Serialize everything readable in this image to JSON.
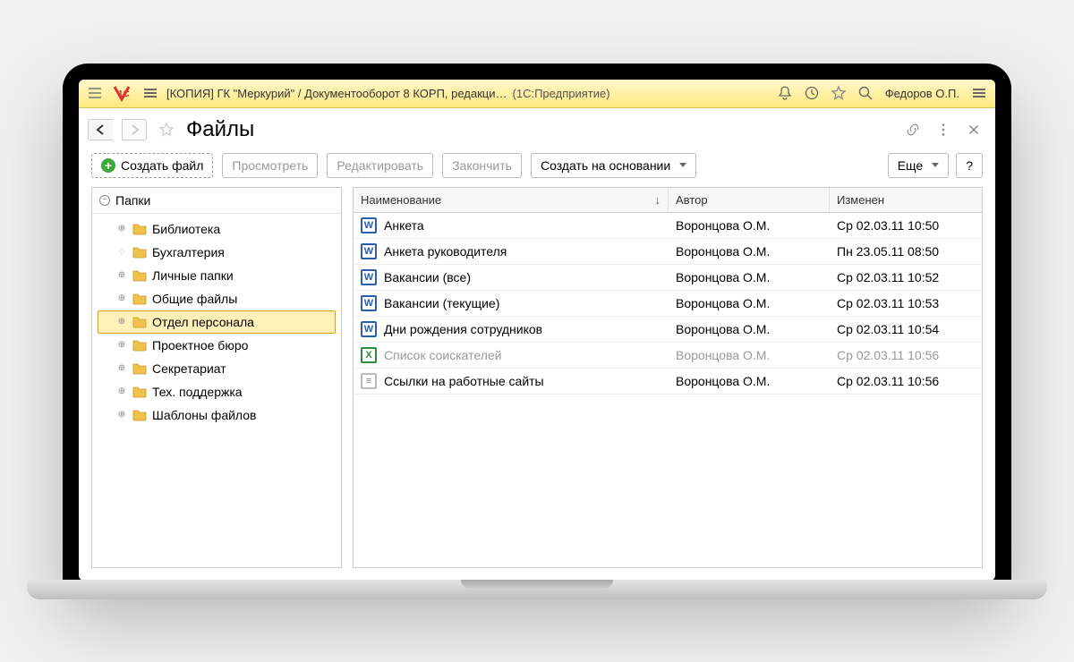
{
  "title_bar": {
    "app_title": "[КОПИЯ] ГК \"Меркурий\" / Документооборот 8 КОРП, редакци…",
    "subsystem": "(1С:Предприятие)",
    "user_name": "Федоров О.П."
  },
  "page": {
    "title": "Файлы"
  },
  "toolbar": {
    "create_file": "Создать файл",
    "view": "Просмотреть",
    "edit": "Редактировать",
    "finish": "Закончить",
    "create_from": "Создать на основании",
    "more": "Еще",
    "help": "?"
  },
  "tree": {
    "root": "Папки",
    "items": [
      {
        "label": "Библиотека",
        "expandable": true
      },
      {
        "label": "Бухгалтерия",
        "expandable": false,
        "loading": true
      },
      {
        "label": "Личные папки",
        "expandable": true
      },
      {
        "label": "Общие файлы",
        "expandable": true
      },
      {
        "label": "Отдел персонала",
        "expandable": true,
        "selected": true
      },
      {
        "label": "Проектное бюро",
        "expandable": true
      },
      {
        "label": "Секретариат",
        "expandable": true
      },
      {
        "label": "Тех. поддержка",
        "expandable": true
      },
      {
        "label": "Шаблоны файлов",
        "expandable": true
      }
    ]
  },
  "grid": {
    "columns": {
      "name": "Наименование",
      "author": "Автор",
      "modified": "Изменен"
    },
    "rows": [
      {
        "type": "word",
        "name": "Анкета",
        "author": "Воронцова О.М.",
        "modified": "Ср 02.03.11 10:50"
      },
      {
        "type": "word",
        "name": "Анкета руководителя",
        "author": "Воронцова О.М.",
        "modified": "Пн 23.05.11 08:50"
      },
      {
        "type": "word",
        "name": "Вакансии (все)",
        "author": "Воронцова О.М.",
        "modified": "Ср 02.03.11 10:52"
      },
      {
        "type": "word",
        "name": "Вакансии (текущие)",
        "author": "Воронцова О.М.",
        "modified": "Ср 02.03.11 10:53"
      },
      {
        "type": "word",
        "name": "Дни рождения сотрудников",
        "author": "Воронцова О.М.",
        "modified": "Ср 02.03.11 10:54"
      },
      {
        "type": "excel",
        "name": "Список соискателей",
        "author": "Воронцова О.М.",
        "modified": "Ср 02.03.11 10:56",
        "muted": true
      },
      {
        "type": "txt",
        "name": "Ссылки на работные сайты",
        "author": "Воронцова О.М.",
        "modified": "Ср 02.03.11 10:56"
      }
    ]
  }
}
